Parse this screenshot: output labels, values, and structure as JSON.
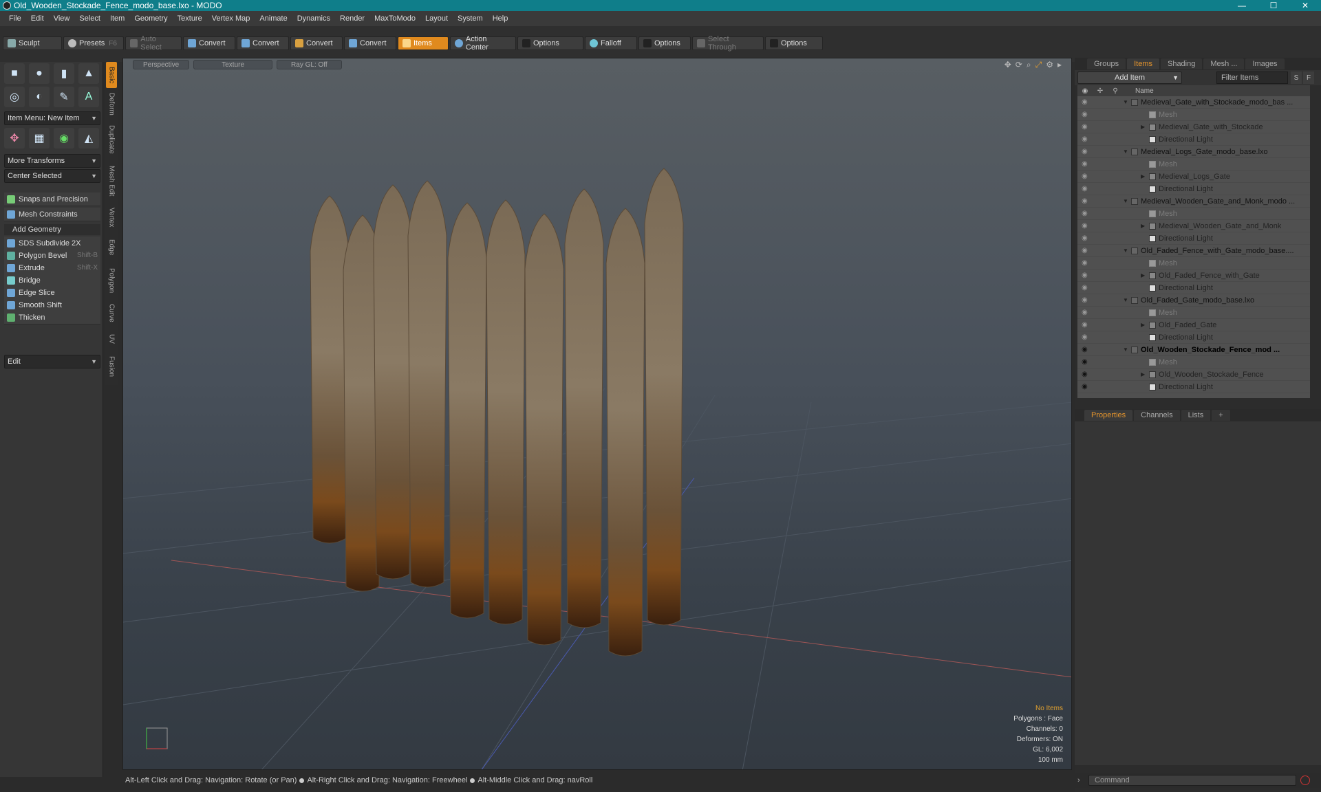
{
  "window": {
    "title": "Old_Wooden_Stockade_Fence_modo_base.lxo - MODO",
    "controls": {
      "minimize": "—",
      "maximize": "☐",
      "close": "✕"
    }
  },
  "menubar": [
    "File",
    "Edit",
    "View",
    "Select",
    "Item",
    "Geometry",
    "Texture",
    "Vertex Map",
    "Animate",
    "Dynamics",
    "Render",
    "MaxToModo",
    "Layout",
    "System",
    "Help"
  ],
  "toolbar": {
    "sculpt": "Sculpt",
    "presets": "Presets",
    "presets_hotkey": "F6",
    "auto_select": "Auto Select",
    "convert1": "Convert",
    "convert2": "Convert",
    "convert3": "Convert",
    "convert4": "Convert",
    "items": "Items",
    "action_center": "Action Center",
    "options1": "Options",
    "falloff": "Falloff",
    "options2": "Options",
    "select_through": "Select Through",
    "options3": "Options"
  },
  "left_panel": {
    "item_menu": "Item Menu: New Item",
    "more_transforms": "More Transforms",
    "center_selected": "Center Selected",
    "snaps": "Snaps and Precision",
    "mesh_constraints": "Mesh Constraints",
    "add_geometry": "Add Geometry",
    "tools": [
      {
        "label": "SDS Subdivide 2X",
        "hotkey": ""
      },
      {
        "label": "Polygon Bevel",
        "hotkey": "Shift-B"
      },
      {
        "label": "Extrude",
        "hotkey": "Shift-X"
      },
      {
        "label": "Bridge",
        "hotkey": ""
      },
      {
        "label": "Edge Slice",
        "hotkey": ""
      },
      {
        "label": "Smooth Shift",
        "hotkey": ""
      },
      {
        "label": "Thicken",
        "hotkey": ""
      }
    ],
    "edit_dropdown": "Edit",
    "vertical_tabs": [
      "Basic",
      "Deform",
      "Duplicate",
      "Mesh Edit",
      "Vertex",
      "Edge",
      "Polygon",
      "Curve",
      "UV",
      "Fusion"
    ]
  },
  "viewport": {
    "view_mode": "Perspective",
    "shading": "Texture",
    "ray_gl": "Ray GL: Off",
    "stats": {
      "selection": "No Items",
      "polygons": "Polygons : Face",
      "channels": "Channels: 0",
      "deformers": "Deformers: ON",
      "gl": "GL: 6,002",
      "scale": "100 mm"
    }
  },
  "statusbar": {
    "hint1": "Alt-Left Click and Drag: Navigation: Rotate (or Pan)",
    "hint2": "Alt-Right Click and Drag: Navigation: Freewheel",
    "hint3": "Alt-Middle Click and Drag: navRoll"
  },
  "right_panel": {
    "tabs": [
      "Groups",
      "Items",
      "Shading",
      "Mesh ...",
      "Images"
    ],
    "active_tab": "Items",
    "add_item": "Add Item",
    "filter_placeholder": "Filter Items",
    "s_btn": "S",
    "f_btn": "F",
    "tree_header": "Name",
    "tree": [
      {
        "type": "group",
        "label": "Medieval_Gate_with_Stockade_modo_bas ...",
        "eye": false
      },
      {
        "type": "mesh",
        "label": "Mesh",
        "eye": false
      },
      {
        "type": "item",
        "label": "Medieval_Gate_with_Stockade",
        "eye": false
      },
      {
        "type": "light",
        "label": "Directional Light",
        "eye": false
      },
      {
        "type": "group",
        "label": "Medieval_Logs_Gate_modo_base.lxo",
        "eye": false
      },
      {
        "type": "mesh",
        "label": "Mesh",
        "eye": false
      },
      {
        "type": "item",
        "label": "Medieval_Logs_Gate",
        "eye": false
      },
      {
        "type": "light",
        "label": "Directional Light",
        "eye": false
      },
      {
        "type": "group",
        "label": "Medieval_Wooden_Gate_and_Monk_modo ...",
        "eye": false
      },
      {
        "type": "mesh",
        "label": "Mesh",
        "eye": false
      },
      {
        "type": "item",
        "label": "Medieval_Wooden_Gate_and_Monk",
        "eye": false
      },
      {
        "type": "light",
        "label": "Directional Light",
        "eye": false
      },
      {
        "type": "group",
        "label": "Old_Faded_Fence_with_Gate_modo_base....",
        "eye": false
      },
      {
        "type": "mesh",
        "label": "Mesh",
        "eye": false
      },
      {
        "type": "item",
        "label": "Old_Faded_Fence_with_Gate",
        "eye": false
      },
      {
        "type": "light",
        "label": "Directional Light",
        "eye": false
      },
      {
        "type": "group",
        "label": "Old_Faded_Gate_modo_base.lxo",
        "eye": false
      },
      {
        "type": "mesh",
        "label": "Mesh",
        "eye": false
      },
      {
        "type": "item",
        "label": "Old_Faded_Gate",
        "eye": false
      },
      {
        "type": "light",
        "label": "Directional Light",
        "eye": false
      },
      {
        "type": "group-bold",
        "label": "Old_Wooden_Stockade_Fence_mod ...",
        "eye": true
      },
      {
        "type": "mesh",
        "label": "Mesh",
        "eye": true
      },
      {
        "type": "item",
        "label": "Old_Wooden_Stockade_Fence",
        "eye": true
      },
      {
        "type": "light",
        "label": "Directional Light",
        "eye": true
      }
    ],
    "props_tabs": [
      "Properties",
      "Channels",
      "Lists",
      "+"
    ],
    "active_props_tab": "Properties",
    "command_placeholder": "Command"
  }
}
